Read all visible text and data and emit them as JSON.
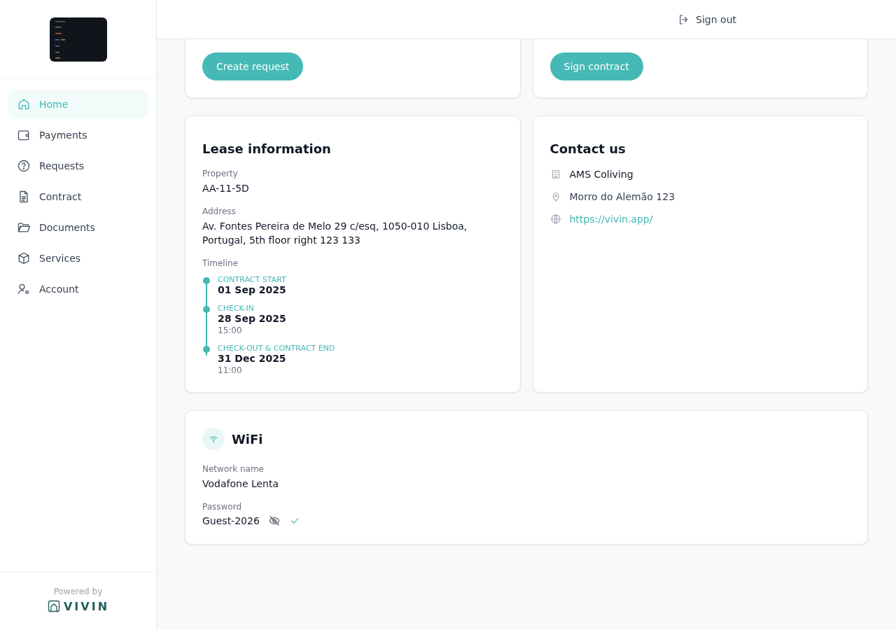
{
  "sidebar": {
    "items": [
      {
        "label": "Home",
        "selected": true
      },
      {
        "label": "Payments",
        "selected": false
      },
      {
        "label": "Requests",
        "selected": false
      },
      {
        "label": "Contract",
        "selected": false
      },
      {
        "label": "Documents",
        "selected": false
      },
      {
        "label": "Services",
        "selected": false
      },
      {
        "label": "Account",
        "selected": false
      }
    ],
    "footer": {
      "powered_by": "Powered by",
      "brand": "VIVIN"
    }
  },
  "header": {
    "sign_out": "Sign out"
  },
  "action_cards": [
    {
      "button": "Create request"
    },
    {
      "button": "Sign contract"
    }
  ],
  "lease": {
    "title": "Lease information",
    "fields": [
      {
        "label": "Property",
        "value": "AA-11-5D"
      },
      {
        "label": "Address",
        "value": "Av. Fontes Pereira de Melo 29 c/esq, 1050-010 Lisboa, Portugal, 5th floor right 123 133"
      }
    ],
    "timeline_label": "Timeline",
    "timeline": [
      {
        "label": "CONTRACT START",
        "date": "01 Sep 2025"
      },
      {
        "label": "CHECK-IN",
        "date": "28 Sep 2025",
        "time": "15:00"
      },
      {
        "label": "CHECK-OUT & CONTRACT END",
        "date": "31 Dec 2025",
        "time": "11:00"
      }
    ]
  },
  "contact": {
    "title": "Contact us",
    "rows": [
      {
        "kind": "text",
        "text": "AMS Coliving"
      },
      {
        "kind": "text",
        "text": "Morro do Alemão 123"
      },
      {
        "kind": "link",
        "text": "https://vivin.app/"
      }
    ]
  },
  "wifi": {
    "title": "WiFi",
    "network_label": "Network name",
    "network": "Vodafone Lenta",
    "password_label": "Password",
    "password": "Guest-2026"
  }
}
